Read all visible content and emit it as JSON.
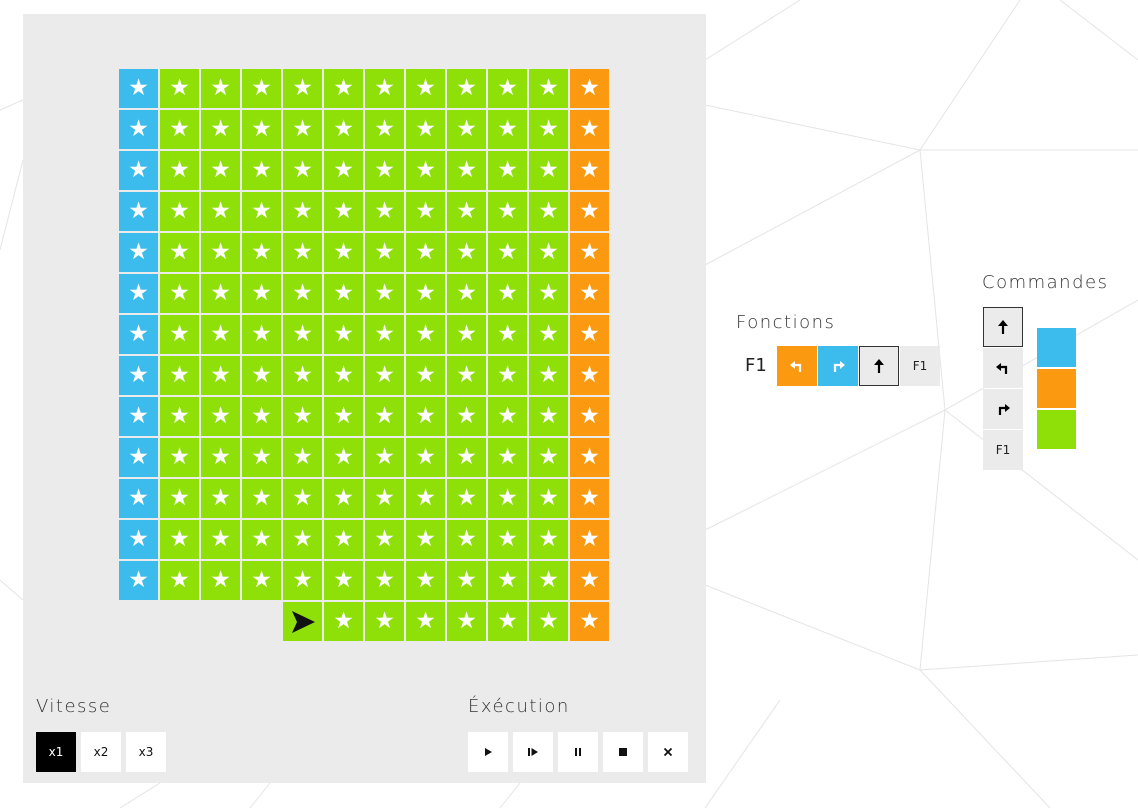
{
  "board": {
    "star_glyph": "★",
    "rows": [
      [
        "blue",
        "green",
        "green",
        "green",
        "green",
        "green",
        "green",
        "green",
        "green",
        "green",
        "green",
        "orange"
      ],
      [
        "blue",
        "green",
        "green",
        "green",
        "green",
        "green",
        "green",
        "green",
        "green",
        "green",
        "green",
        "orange"
      ],
      [
        "blue",
        "green",
        "green",
        "green",
        "green",
        "green",
        "green",
        "green",
        "green",
        "green",
        "green",
        "orange"
      ],
      [
        "blue",
        "green",
        "green",
        "green",
        "green",
        "green",
        "green",
        "green",
        "green",
        "green",
        "green",
        "orange"
      ],
      [
        "blue",
        "green",
        "green",
        "green",
        "green",
        "green",
        "green",
        "green",
        "green",
        "green",
        "green",
        "orange"
      ],
      [
        "blue",
        "green",
        "green",
        "green",
        "green",
        "green",
        "green",
        "green",
        "green",
        "green",
        "green",
        "orange"
      ],
      [
        "blue",
        "green",
        "green",
        "green",
        "green",
        "green",
        "green",
        "green",
        "green",
        "green",
        "green",
        "orange"
      ],
      [
        "blue",
        "green",
        "green",
        "green",
        "green",
        "green",
        "green",
        "green",
        "green",
        "green",
        "green",
        "orange"
      ],
      [
        "blue",
        "green",
        "green",
        "green",
        "green",
        "green",
        "green",
        "green",
        "green",
        "green",
        "green",
        "orange"
      ],
      [
        "blue",
        "green",
        "green",
        "green",
        "green",
        "green",
        "green",
        "green",
        "green",
        "green",
        "green",
        "orange"
      ],
      [
        "blue",
        "green",
        "green",
        "green",
        "green",
        "green",
        "green",
        "green",
        "green",
        "green",
        "green",
        "orange"
      ],
      [
        "blue",
        "green",
        "green",
        "green",
        "green",
        "green",
        "green",
        "green",
        "green",
        "green",
        "green",
        "orange"
      ],
      [
        "blue",
        "green",
        "green",
        "green",
        "green",
        "green",
        "green",
        "green",
        "green",
        "green",
        "green",
        "orange"
      ],
      [
        null,
        null,
        null,
        null,
        "green",
        "green",
        "green",
        "green",
        "green",
        "green",
        "green",
        "orange"
      ]
    ],
    "robot": {
      "row": 13,
      "col": 4,
      "direction": "right",
      "icon": "robot-arrow-icon"
    }
  },
  "colors": {
    "blue": "#3bbcec",
    "green": "#8fe008",
    "orange": "#fb9a10",
    "panel": "#ebebeb"
  },
  "speed": {
    "title": "Vitesse",
    "options": [
      "x1",
      "x2",
      "x3"
    ],
    "selected": "x1"
  },
  "execution": {
    "title": "Éxécution",
    "buttons": [
      {
        "name": "play",
        "icon": "play-icon"
      },
      {
        "name": "step",
        "icon": "step-icon"
      },
      {
        "name": "pause",
        "icon": "pause-icon"
      },
      {
        "name": "stop",
        "icon": "stop-icon"
      },
      {
        "name": "clear",
        "icon": "close-icon"
      }
    ]
  },
  "functions": {
    "title": "Fonctions",
    "f1": {
      "label": "F1",
      "slots": [
        {
          "color": "orange",
          "command": "turn-left-icon"
        },
        {
          "color": "blue",
          "command": "turn-right-icon"
        },
        {
          "color": "none",
          "command": "arrow-up-icon",
          "selected": true
        },
        {
          "color": "none",
          "command": "F1"
        }
      ]
    }
  },
  "commands": {
    "title": "Commandes",
    "items": [
      {
        "command": "arrow-up-icon",
        "selected": true
      },
      {
        "command": "turn-left-icon"
      },
      {
        "command": "turn-right-icon"
      },
      {
        "command": "F1"
      }
    ],
    "colors": [
      "blue",
      "orange",
      "green"
    ]
  }
}
